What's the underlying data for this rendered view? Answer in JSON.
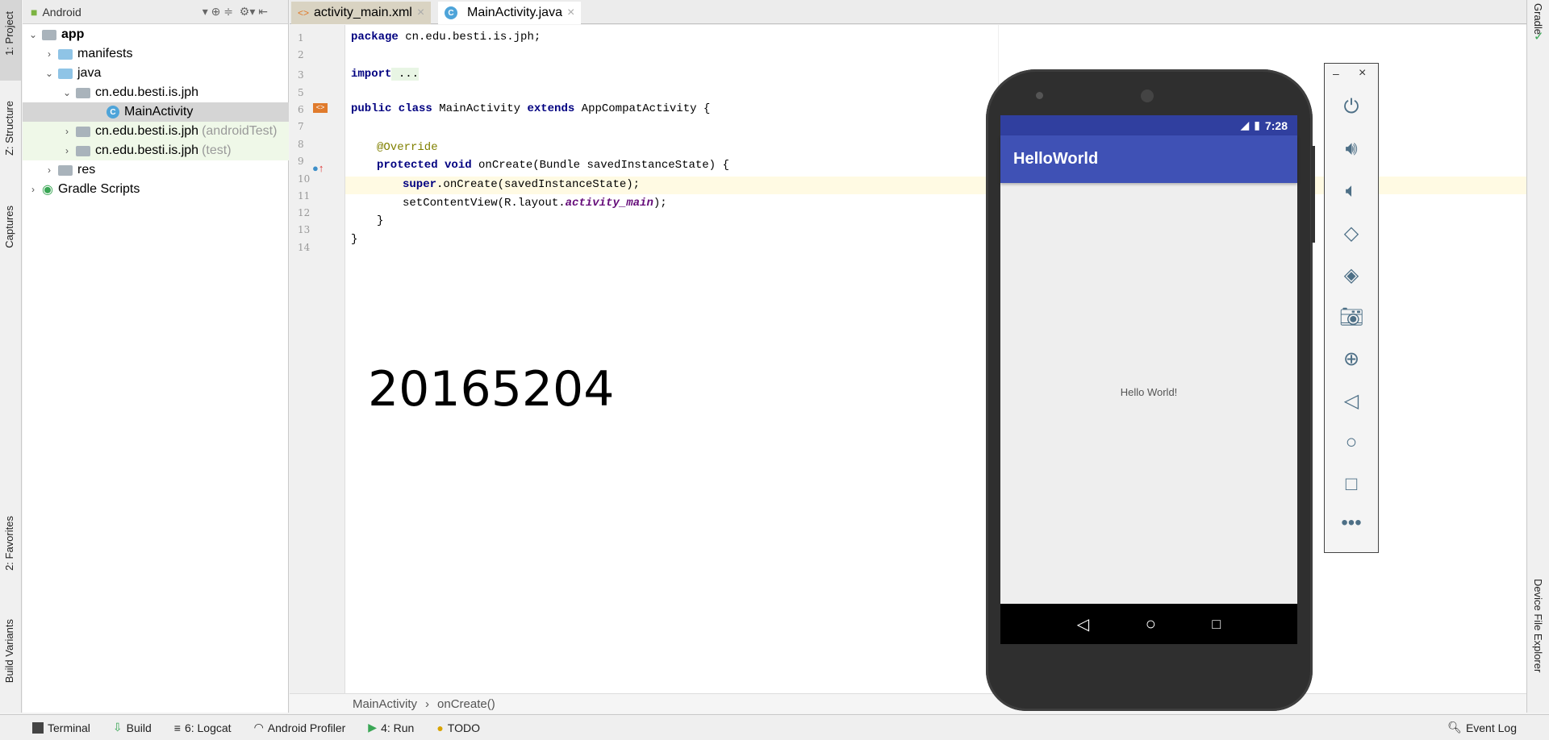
{
  "left_strip": {
    "project": "1: Project",
    "structure": "Z: Structure",
    "captures": "Captures",
    "favorites": "2: Favorites",
    "build_variants": "Build Variants"
  },
  "right_strip": {
    "gradle": "Gradle",
    "device_file_explorer": "Device File Explorer"
  },
  "project_panel": {
    "view_selector": "Android",
    "tree": [
      {
        "label": "app",
        "suffix": "",
        "kind": "module",
        "expanded": true
      },
      {
        "label": "manifests",
        "suffix": "",
        "kind": "folder",
        "expanded": false
      },
      {
        "label": "java",
        "suffix": "",
        "kind": "folder",
        "expanded": true
      },
      {
        "label": "cn.edu.besti.is.jph",
        "suffix": "",
        "kind": "package",
        "expanded": true
      },
      {
        "label": "MainActivity",
        "suffix": "",
        "kind": "class",
        "selected": true
      },
      {
        "label": "cn.edu.besti.is.jph",
        "suffix": "(androidTest)",
        "kind": "package",
        "expanded": false
      },
      {
        "label": "cn.edu.besti.is.jph",
        "suffix": "(test)",
        "kind": "package",
        "expanded": false
      },
      {
        "label": "res",
        "suffix": "",
        "kind": "folder",
        "expanded": false
      },
      {
        "label": "Gradle Scripts",
        "suffix": "",
        "kind": "gradle",
        "expanded": false
      }
    ]
  },
  "tabs": [
    {
      "label": "activity_main.xml",
      "active": false
    },
    {
      "label": "MainActivity.java",
      "active": true
    }
  ],
  "editor": {
    "line_numbers": [
      "1",
      "2",
      "3",
      "5",
      "6",
      "7",
      "8",
      "9",
      "10",
      "11",
      "12",
      "13",
      "14"
    ],
    "lines": {
      "l1a": "package",
      "l1b": " cn.edu.besti.is.jph;",
      "l3a": "import",
      "l3b": " ...",
      "l6a": "public class",
      "l6b": " MainActivity ",
      "l6c": "extends",
      "l6d": " AppCompatActivity {",
      "l8": "@Override",
      "l9a": "protected void",
      "l9b": " onCreate(Bundle savedInstanceState) {",
      "l10a": "super",
      "l10b": ".onCreate(savedInstanceState);",
      "l11a": "setContentView(R.layout.",
      "l11b": "activity_main",
      "l11c": ");",
      "l12": "}",
      "l13": "}"
    },
    "overlay_number": "20165204",
    "breadcrumb": [
      "MainActivity",
      "onCreate()"
    ]
  },
  "bottom_bar": {
    "terminal": "Terminal",
    "build": "Build",
    "logcat": "6: Logcat",
    "profiler": "Android Profiler",
    "run": "4: Run",
    "todo": "TODO",
    "event_log": "Event Log"
  },
  "emulator": {
    "time": "7:28",
    "app_title": "HelloWorld",
    "content": "Hello World!",
    "colors": {
      "status": "#303f9f",
      "appbar": "#3f51b5"
    }
  },
  "emulator_controls": [
    "power",
    "volume-up",
    "volume-down",
    "rotate-left",
    "rotate-right",
    "screenshot",
    "zoom",
    "back",
    "home",
    "overview",
    "more"
  ]
}
